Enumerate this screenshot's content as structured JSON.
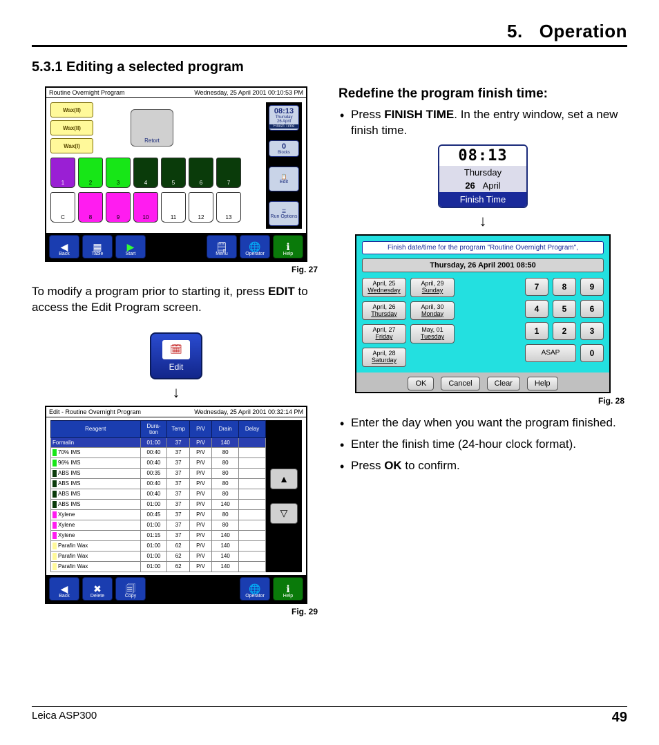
{
  "chapter": {
    "number": "5.",
    "title": "Operation"
  },
  "section_heading": "5.3.1 Editing a selected program",
  "left": {
    "fig27": {
      "title_left": "Routine Overnight Program",
      "title_right": "Wednesday, 25 April 2001 00:10:53 PM",
      "wax": [
        "Wax(II)",
        "Wax(II)",
        "Wax(I)"
      ],
      "retort": "Retort",
      "side_time": "08:13",
      "side_time_sub": "Thursday\n26 April",
      "side_time_lbl": "Finish Time",
      "side_blocks": "0",
      "side_blocks_lbl": "Blocks",
      "side_edit": "Edit",
      "side_runopt": "Run Options",
      "row1": [
        "1",
        "2",
        "3",
        "4",
        "5",
        "6",
        "7"
      ],
      "row2": [
        "C",
        "8",
        "9",
        "10",
        "11",
        "12",
        "13"
      ],
      "bottom": {
        "back": "Back",
        "table": "Table",
        "start": "Start",
        "menu": "Menu",
        "operator": "Operator",
        "help": "Help"
      },
      "caption": "Fig. 27"
    },
    "para1_a": "To modify a program prior to starting it, press ",
    "para1_b": "EDIT",
    "para1_c": " to access the Edit Program screen.",
    "edit_badge": "Edit",
    "fig29": {
      "title_left": "Edit - Routine Overnight Program",
      "title_right": "Wednesday, 25 April 2001 00:32:14 PM",
      "headers": [
        "Reagent",
        "Dura-\ntion",
        "Temp",
        "P/V",
        "Drain",
        "Delay"
      ],
      "rows": [
        {
          "mark": "",
          "sel": true,
          "c": [
            "Formalin",
            "01:00",
            "37",
            "P/V",
            "140",
            ""
          ]
        },
        {
          "mark": "m-green",
          "c": [
            "70% IMS",
            "00:40",
            "37",
            "P/V",
            "80",
            ""
          ]
        },
        {
          "mark": "m-green",
          "c": [
            "96% IMS",
            "00:40",
            "37",
            "P/V",
            "80",
            ""
          ]
        },
        {
          "mark": "m-dark",
          "c": [
            "ABS IMS",
            "00:35",
            "37",
            "P/V",
            "80",
            ""
          ]
        },
        {
          "mark": "m-dark",
          "c": [
            "ABS IMS",
            "00:40",
            "37",
            "P/V",
            "80",
            ""
          ]
        },
        {
          "mark": "m-dark",
          "c": [
            "ABS IMS",
            "00:40",
            "37",
            "P/V",
            "80",
            ""
          ]
        },
        {
          "mark": "m-dark",
          "c": [
            "ABS IMS",
            "01:00",
            "37",
            "P/V",
            "140",
            ""
          ]
        },
        {
          "mark": "m-pink",
          "c": [
            "Xylene",
            "00:45",
            "37",
            "P/V",
            "80",
            ""
          ]
        },
        {
          "mark": "m-pink",
          "c": [
            "Xylene",
            "01:00",
            "37",
            "P/V",
            "80",
            ""
          ]
        },
        {
          "mark": "m-pink",
          "c": [
            "Xylene",
            "01:15",
            "37",
            "P/V",
            "140",
            ""
          ]
        },
        {
          "mark": "m-yellow",
          "c": [
            "Parafin Wax",
            "01:00",
            "62",
            "P/V",
            "140",
            ""
          ]
        },
        {
          "mark": "m-yellow",
          "c": [
            "Parafin Wax",
            "01:00",
            "62",
            "P/V",
            "140",
            ""
          ]
        },
        {
          "mark": "m-yellow",
          "c": [
            "Parafin Wax",
            "01:00",
            "62",
            "P/V",
            "140",
            ""
          ]
        }
      ],
      "bottom": {
        "back": "Back",
        "delete": "Delete",
        "copy": "Copy",
        "operator": "Operator",
        "help": "Help"
      },
      "caption": "Fig. 29"
    }
  },
  "right": {
    "subhead": "Redefine the program finish time:",
    "bullet1_a": "Press ",
    "bullet1_b": "FINISH TIME",
    "bullet1_c": ". In the entry window, set a new finish time.",
    "finish": {
      "time": "08:13",
      "day": "Thursday",
      "date": "26",
      "month": "April",
      "label": "Finish Time"
    },
    "fig28": {
      "title": "Finish date/time for the program \"Routine Overnight Program\",",
      "datetime": "Thursday, 26 April 2001    08:50",
      "days": [
        [
          "April, 25",
          "Wednesday"
        ],
        [
          "April, 29",
          "Sunday"
        ],
        [
          "April, 26",
          "Thursday"
        ],
        [
          "April, 30",
          "Monday"
        ],
        [
          "April, 27",
          "Friday"
        ],
        [
          "May, 01",
          "Tuesday"
        ],
        [
          "April, 28",
          "Saturday"
        ]
      ],
      "numbers": [
        "7",
        "8",
        "9",
        "4",
        "5",
        "6",
        "1",
        "2",
        "3"
      ],
      "asap": "ASAP",
      "zero": "0",
      "buttons": [
        "OK",
        "Cancel",
        "Clear",
        "Help"
      ],
      "caption": "Fig. 28"
    },
    "bullets_after": [
      "Enter the day when you want the program finished.",
      "Enter the finish time (24-hour clock format)."
    ],
    "bullet_ok_a": "Press ",
    "bullet_ok_b": "OK",
    "bullet_ok_c": " to confirm."
  },
  "footer": {
    "product": "Leica  ASP300",
    "page": "49"
  }
}
